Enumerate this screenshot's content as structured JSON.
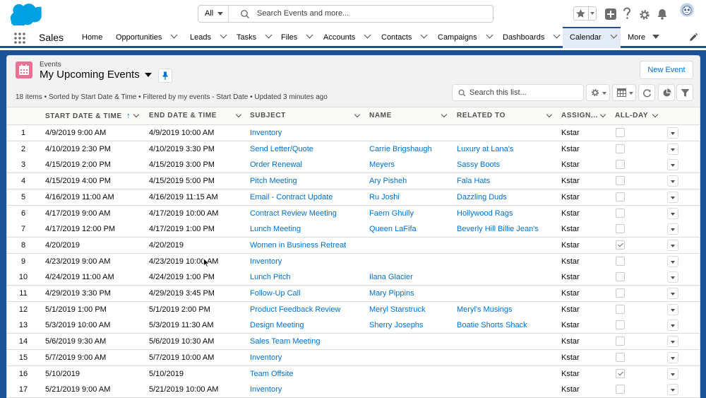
{
  "header": {
    "search_scope": "All",
    "search_placeholder": "Search Events and more..."
  },
  "nav": {
    "app_name": "Sales",
    "items": [
      {
        "label": "Home",
        "chevron": false
      },
      {
        "label": "Opportunities",
        "chevron": true
      },
      {
        "label": "Leads",
        "chevron": true
      },
      {
        "label": "Tasks",
        "chevron": true
      },
      {
        "label": "Files",
        "chevron": true
      },
      {
        "label": "Accounts",
        "chevron": true
      },
      {
        "label": "Contacts",
        "chevron": true
      },
      {
        "label": "Campaigns",
        "chevron": true
      },
      {
        "label": "Dashboards",
        "chevron": true
      },
      {
        "label": "Calendar",
        "chevron": true,
        "active": true
      },
      {
        "label": "More",
        "chevron": false,
        "caret": true
      }
    ]
  },
  "list": {
    "object_label": "Events",
    "title": "My Upcoming Events",
    "new_button": "New Event",
    "meta": "18 items • Sorted by Start Date & Time • Filtered by my events - Start Date • Updated 3 minutes ago",
    "search_placeholder": "Search this list...",
    "columns": [
      "START DATE & TIME",
      "END DATE & TIME",
      "SUBJECT",
      "NAME",
      "RELATED TO",
      "ASSIGN...",
      "ALL-DAY"
    ],
    "sort_arrow": "↑",
    "rows": [
      {
        "n": "1",
        "start": "4/9/2019 9:00 AM",
        "end": "4/9/2019 10:00 AM",
        "subject": "Inventory",
        "name": "",
        "related": "",
        "assigned": "Kstar",
        "allday": false
      },
      {
        "n": "2",
        "start": "4/10/2019 2:30 PM",
        "end": "4/10/2019 3:30 PM",
        "subject": "Send Letter/Quote",
        "name": "Carrie Brigshaugh",
        "related": "Luxury at Lana's",
        "assigned": "Kstar",
        "allday": false
      },
      {
        "n": "3",
        "start": "4/15/2019 2:00 PM",
        "end": "4/15/2019 3:00 PM",
        "subject": "Order Renewal",
        "name": "Meyers",
        "related": "Sassy Boots",
        "assigned": "Kstar",
        "allday": false
      },
      {
        "n": "4",
        "start": "4/15/2019 4:00 PM",
        "end": "4/15/2019 5:00 PM",
        "subject": "Pitch Meeting",
        "name": "Ary Pisheh",
        "related": "Fala Hats",
        "assigned": "Kstar",
        "allday": false
      },
      {
        "n": "5",
        "start": "4/16/2019 11:00 AM",
        "end": "4/16/2019 11:15 AM",
        "subject": "Email - Contract Update",
        "name": "Ru Joshi",
        "related": "Dazzling Duds",
        "assigned": "Kstar",
        "allday": false
      },
      {
        "n": "6",
        "start": "4/17/2019 9:00 AM",
        "end": "4/17/2019 10:00 AM",
        "subject": "Contract Review Meeting",
        "name": "Faern Ghully",
        "related": "Hollywood Rags",
        "assigned": "Kstar",
        "allday": false
      },
      {
        "n": "7",
        "start": "4/17/2019 12:00 PM",
        "end": "4/17/2019 1:00 PM",
        "subject": "Lunch Meeting",
        "name": "Queen LaFifa",
        "related": "Beverly Hill Billie Jean's",
        "assigned": "Kstar",
        "allday": false
      },
      {
        "n": "8",
        "start": "4/20/2019",
        "end": "4/20/2019",
        "subject": "Women in Business Retreat",
        "name": "",
        "related": "",
        "assigned": "Kstar",
        "allday": true
      },
      {
        "n": "9",
        "start": "4/23/2019 9:00 AM",
        "end": "4/23/2019 10:00 AM",
        "subject": "Inventory",
        "name": "",
        "related": "",
        "assigned": "Kstar",
        "allday": false
      },
      {
        "n": "10",
        "start": "4/24/2019 11:00 AM",
        "end": "4/24/2019 1:00 PM",
        "subject": "Lunch Pitch",
        "name": "Ilana Glacier",
        "related": "",
        "assigned": "Kstar",
        "allday": false
      },
      {
        "n": "11",
        "start": "4/29/2019 3:30 PM",
        "end": "4/29/2019 3:45 PM",
        "subject": "Follow-Up Call",
        "name": "Mary Pippins",
        "related": "",
        "assigned": "Kstar",
        "allday": false
      },
      {
        "n": "12",
        "start": "5/1/2019 1:00 PM",
        "end": "5/1/2019 2:00 PM",
        "subject": "Product Feedback Review",
        "name": "Meryl Starstruck",
        "related": "Meryl's Musings",
        "assigned": "Kstar",
        "allday": false
      },
      {
        "n": "13",
        "start": "5/3/2019 10:00 AM",
        "end": "5/3/2019 11:30 AM",
        "subject": "Design Meeting",
        "name": "Sherry Josephs",
        "related": "Boatie Shorts Shack",
        "assigned": "Kstar",
        "allday": false
      },
      {
        "n": "14",
        "start": "5/6/2019 9:30 AM",
        "end": "5/6/2019 10:30 AM",
        "subject": "Sales Team Meeting",
        "name": "",
        "related": "",
        "assigned": "Kstar",
        "allday": false
      },
      {
        "n": "15",
        "start": "5/7/2019 9:00 AM",
        "end": "5/7/2019 10:00 AM",
        "subject": "Inventory",
        "name": "",
        "related": "",
        "assigned": "Kstar",
        "allday": false
      },
      {
        "n": "16",
        "start": "5/10/2019",
        "end": "5/10/2019",
        "subject": "Team Offsite",
        "name": "",
        "related": "",
        "assigned": "Kstar",
        "allday": true
      },
      {
        "n": "17",
        "start": "5/21/2019 9:00 AM",
        "end": "5/21/2019 10:00 AM",
        "subject": "Inventory",
        "name": "",
        "related": "",
        "assigned": "Kstar",
        "allday": false
      }
    ]
  },
  "colors": {
    "brand": "#1b5297",
    "link": "#0070d2",
    "event_icon": "#eb7092"
  }
}
